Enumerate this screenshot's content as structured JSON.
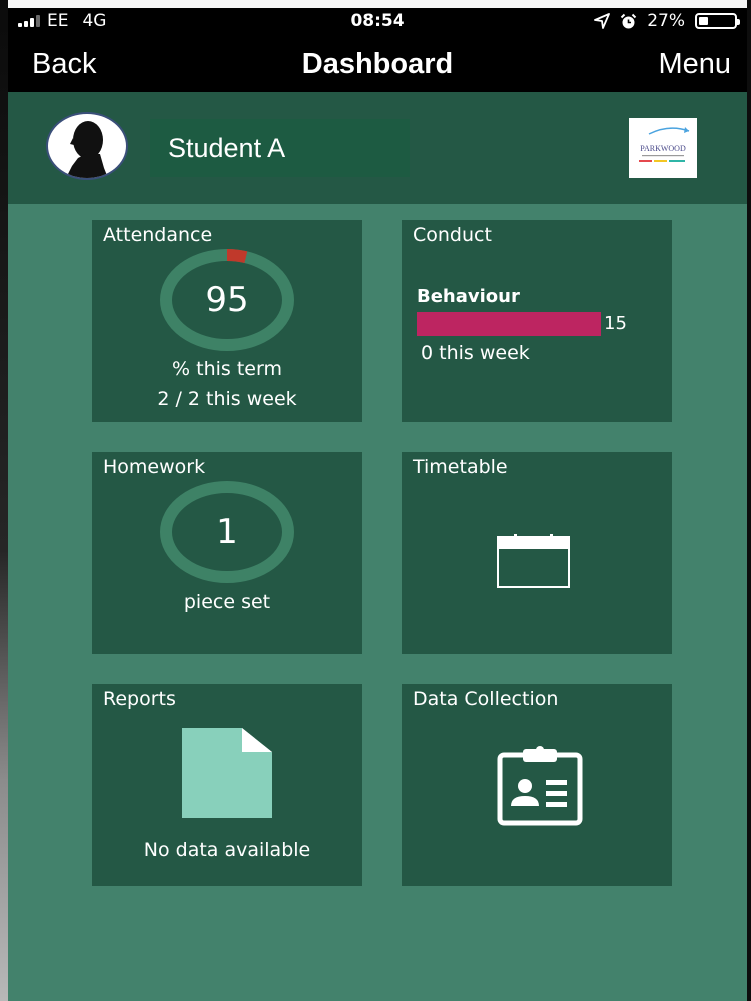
{
  "status_bar": {
    "carrier": "EE",
    "network": "4G",
    "time": "08:54",
    "battery": "27%",
    "battery_level": 0.27
  },
  "nav": {
    "back": "Back",
    "title": "Dashboard",
    "menu": "Menu"
  },
  "student": {
    "name": "Student A",
    "logo_text": "PARKWOOD"
  },
  "tiles": {
    "attendance": {
      "title": "Attendance",
      "value": "95",
      "value_pct": 95,
      "line1": "% this term",
      "line2": "2 / 2 this week"
    },
    "conduct": {
      "title": "Conduct",
      "label": "Behaviour",
      "count": "15",
      "week": "0 this week"
    },
    "homework": {
      "title": "Homework",
      "value": "1",
      "line1": "piece set"
    },
    "timetable": {
      "title": "Timetable",
      "icon": "calendar-icon"
    },
    "reports": {
      "title": "Reports",
      "icon": "document-icon",
      "empty": "No data available"
    },
    "data_collection": {
      "title": "Data Collection",
      "icon": "clipboard-icon"
    }
  },
  "colors": {
    "page_bg": "#43826c",
    "tile_bg": "#245845",
    "ring": "#3e8266",
    "ring_missing": "#c0392b",
    "behaviour_bar": "#bd2561",
    "document": "#88d0bb"
  }
}
